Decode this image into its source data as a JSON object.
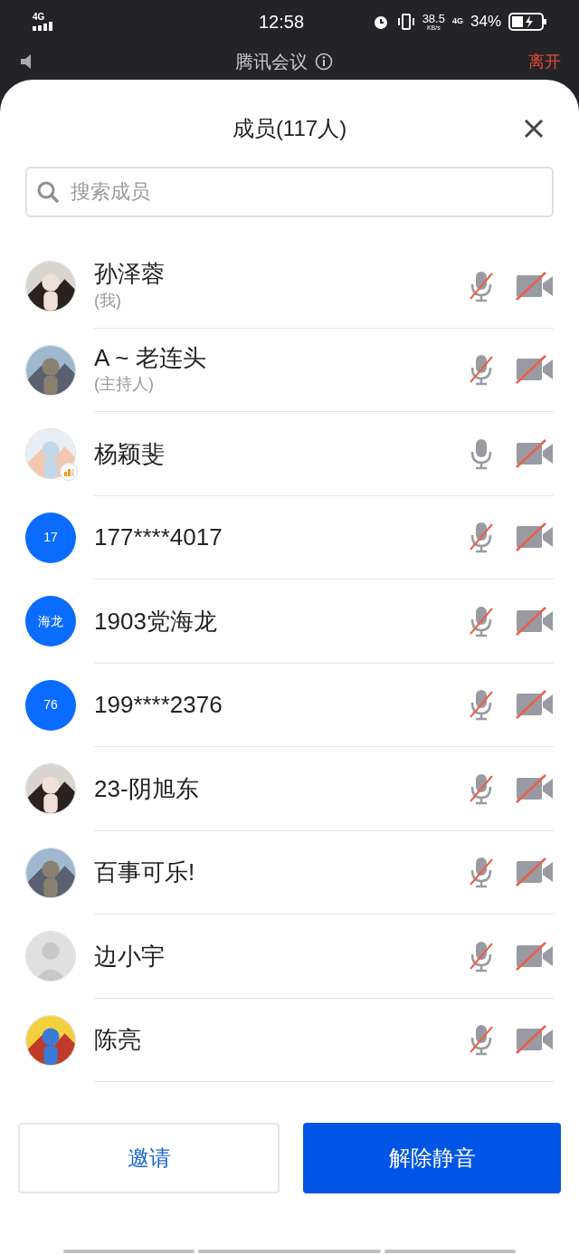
{
  "status_bar": {
    "network": "4G",
    "data_label": "4G",
    "time": "12:58",
    "speed": "38.5",
    "speed_unit": "KB/s",
    "battery": "34%"
  },
  "app_header": {
    "title": "腾讯会议",
    "leave": "离开"
  },
  "sheet": {
    "title": "成员(117人)"
  },
  "search": {
    "placeholder": "搜索成员"
  },
  "members": [
    {
      "name": "孙泽蓉",
      "role": "(我)",
      "mic_muted": true,
      "camera_off": true,
      "speaking": false
    },
    {
      "name": "A ~ 老连头",
      "role": "(主持人)",
      "mic_muted": true,
      "camera_off": true,
      "speaking": false
    },
    {
      "name": "杨颖斐",
      "mic_muted": false,
      "camera_off": true,
      "speaking": true
    },
    {
      "name": "177****4017",
      "avatar": {
        "kind": "initials",
        "text": "17"
      },
      "mic_muted": true,
      "camera_off": true,
      "speaking": false
    },
    {
      "name": "1903党海龙",
      "avatar": {
        "kind": "initials",
        "text": "海龙"
      },
      "mic_muted": true,
      "camera_off": true,
      "speaking": false
    },
    {
      "name": "199****2376",
      "avatar": {
        "kind": "initials",
        "text": "76"
      },
      "mic_muted": true,
      "camera_off": true,
      "speaking": false
    },
    {
      "name": "23-阴旭东",
      "mic_muted": true,
      "camera_off": true,
      "speaking": false
    },
    {
      "name": "百事可乐!",
      "mic_muted": true,
      "camera_off": true,
      "speaking": false
    },
    {
      "name": "边小宇",
      "avatar": {
        "kind": "default"
      },
      "mic_muted": true,
      "camera_off": true,
      "speaking": false
    },
    {
      "name": "陈亮",
      "mic_muted": true,
      "camera_off": true,
      "speaking": false
    }
  ],
  "buttons": [
    {
      "label": "邀请",
      "kind": "secondary"
    },
    {
      "label": "解除静音",
      "kind": "primary"
    }
  ]
}
